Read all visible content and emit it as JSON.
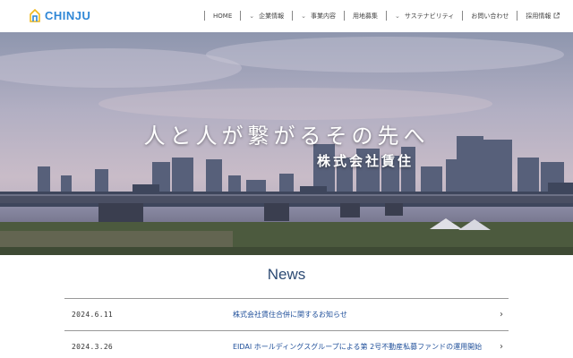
{
  "brand": {
    "name": "CHINJU",
    "accent": "#2f87d6"
  },
  "nav": {
    "items": [
      {
        "label": "HOME",
        "dropdown": false
      },
      {
        "label": "企業情報",
        "dropdown": true
      },
      {
        "label": "事業内容",
        "dropdown": true
      },
      {
        "label": "用地募集",
        "dropdown": false
      },
      {
        "label": "サステナビリティ",
        "dropdown": true
      },
      {
        "label": "お問い合わせ",
        "dropdown": false
      },
      {
        "label": "採用情報",
        "dropdown": false,
        "external": true
      }
    ]
  },
  "hero": {
    "tagline": "人と人が繋がるその先へ",
    "company": "株式会社賃住"
  },
  "news": {
    "title": "News",
    "items": [
      {
        "date": "2024.6.11",
        "text": "株式会社賃住合併に関するお知らせ"
      },
      {
        "date": "2024.3.26",
        "text": "EIDAI ホールディングスグループによる第 2号不動産私募ファンドの運用開始"
      }
    ]
  },
  "icons": {
    "logo": "house-logo-icon",
    "dropdown": "chevron-down-icon",
    "external": "external-link-icon",
    "row_arrow": "chevron-right-icon"
  }
}
